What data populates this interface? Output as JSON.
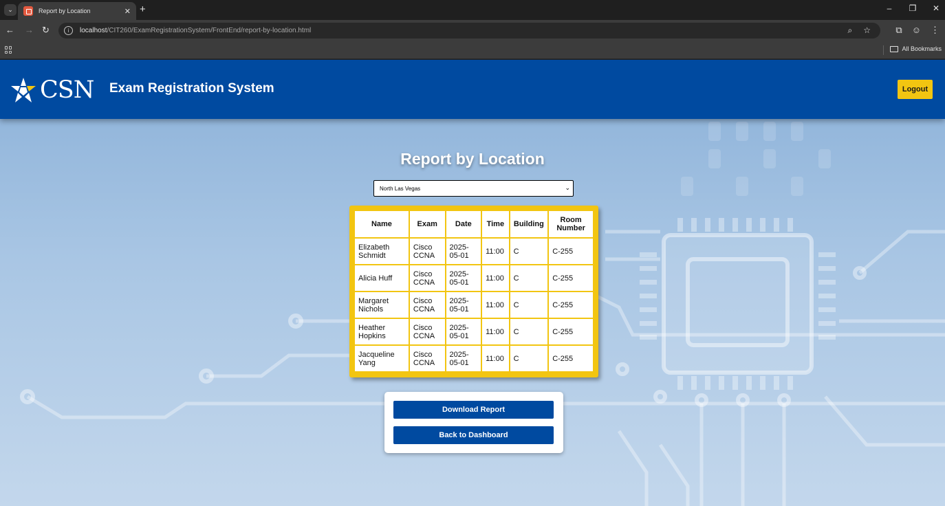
{
  "browser": {
    "tab_title": "Report by Location",
    "tab_close": "✕",
    "new_tab": "+",
    "url_host": "localhost",
    "url_path": "/CIT260/ExamRegistrationSystem/FrontEnd/report-by-location.html",
    "all_bookmarks": "All Bookmarks"
  },
  "header": {
    "logo_text": "CSN",
    "site_title": "Exam Registration System",
    "logout_label": "Logout",
    "colors": {
      "primary": "#004aa0",
      "accent": "#f2c511"
    }
  },
  "main": {
    "title": "Report by Location",
    "location_select": {
      "selected": "North Las Vegas"
    },
    "table": {
      "headers": [
        "Name",
        "Exam",
        "Date",
        "Time",
        "Building",
        "Room Number"
      ],
      "rows": [
        [
          "Elizabeth Schmidt",
          "Cisco CCNA",
          "2025-05-01",
          "11:00",
          "C",
          "C-255"
        ],
        [
          "Alicia Huff",
          "Cisco CCNA",
          "2025-05-01",
          "11:00",
          "C",
          "C-255"
        ],
        [
          "Margaret Nichols",
          "Cisco CCNA",
          "2025-05-01",
          "11:00",
          "C",
          "C-255"
        ],
        [
          "Heather Hopkins",
          "Cisco CCNA",
          "2025-05-01",
          "11:00",
          "C",
          "C-255"
        ],
        [
          "Jacqueline Yang",
          "Cisco CCNA",
          "2025-05-01",
          "11:00",
          "C",
          "C-255"
        ]
      ]
    },
    "actions": {
      "download_label": "Download Report",
      "dashboard_label": "Back to Dashboard"
    }
  }
}
